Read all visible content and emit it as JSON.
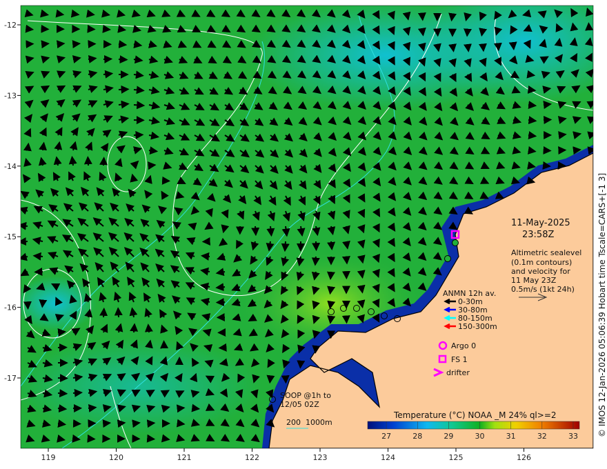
{
  "map": {
    "lon_ticks": [
      "119",
      "120",
      "121",
      "122",
      "123",
      "124",
      "125",
      "126"
    ],
    "lat_ticks": [
      "-12",
      "-13",
      "-14",
      "-15",
      "-16",
      "-17"
    ],
    "colors": {
      "ocean_base": "#22b03a",
      "land": "#fccb9b",
      "coast": "#000000",
      "contour": "#ffffff",
      "isobath": "#30e0e0"
    }
  },
  "timestamp": {
    "date": "11-May-2025",
    "time": "23:58Z"
  },
  "altimetry_note": [
    "Altimetric sealevel",
    "(0.1m contours)",
    "and velocity for",
    "11 May 23Z",
    "0.5m/s (1kt 24h)"
  ],
  "anmn_legend": {
    "title": "ANMN 12h av.",
    "items": [
      {
        "label": "0-30m",
        "color": "#000000"
      },
      {
        "label": "30-80m",
        "color": "#0000ff"
      },
      {
        "label": "80-150m",
        "color": "#00ffff"
      },
      {
        "label": "150-300m",
        "color": "#ff0000"
      }
    ]
  },
  "markers": [
    {
      "label": "Argo 0",
      "icon": "circle-icon",
      "color": "#ff00ff"
    },
    {
      "label": "FS 1",
      "icon": "square-icon",
      "color": "#ff00ff"
    },
    {
      "label": "drifter",
      "icon": "chevron-icon",
      "color": "#ff00ff"
    }
  ],
  "soop": {
    "line1": "SOOP @1h to",
    "line2": "12/05 02Z"
  },
  "isobath_legend": "200  1000m",
  "colorbar": {
    "title": "Temperature (°C) NOAA _M 24% ql>=2",
    "ticks": [
      "27",
      "28",
      "29",
      "30",
      "31",
      "32",
      "33"
    ],
    "range": [
      26.4,
      33.2
    ]
  },
  "credit": "© IMOS 12-Jan-2026 05:06:39 Hobart time Tscale=CARS+[-1 3]"
}
